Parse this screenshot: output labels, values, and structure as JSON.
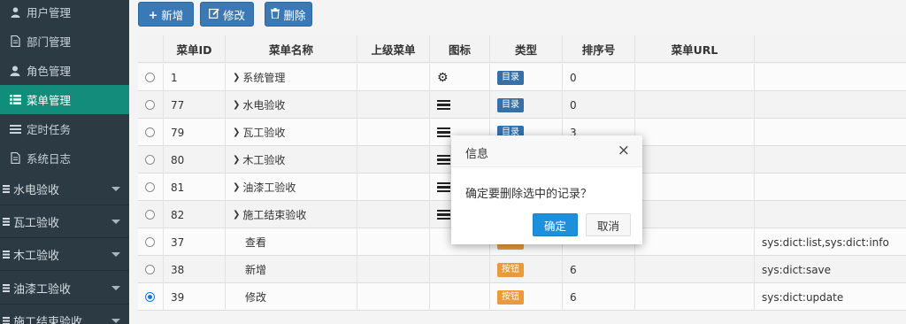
{
  "sidebar": {
    "items": [
      {
        "label": "用户管理",
        "icon": "user-icon"
      },
      {
        "label": "部门管理",
        "icon": "document-icon"
      },
      {
        "label": "角色管理",
        "icon": "role-icon"
      },
      {
        "label": "菜单管理",
        "icon": "list-icon",
        "active": true
      },
      {
        "label": "定时任务",
        "icon": "tasks-icon"
      },
      {
        "label": "系统日志",
        "icon": "document-icon"
      }
    ],
    "groups": [
      {
        "label": "水电验收"
      },
      {
        "label": "瓦工验收"
      },
      {
        "label": "木工验收"
      },
      {
        "label": "油漆工验收"
      },
      {
        "label": "施工结束验收"
      }
    ]
  },
  "toolbar": {
    "add_label": "新增",
    "edit_label": "修改",
    "delete_label": "删除"
  },
  "table": {
    "headers": [
      "",
      "菜单ID",
      "菜单名称",
      "上级菜单",
      "图标",
      "类型",
      "排序号",
      "菜单URL",
      ""
    ],
    "rows": [
      {
        "id": "1",
        "name": "系统管理",
        "parent": "",
        "icon": "gear",
        "type": "目录",
        "type_kind": "dir",
        "order": "0",
        "url": "",
        "perms": "",
        "expand": true,
        "checked": false
      },
      {
        "id": "77",
        "name": "水电验收",
        "parent": "",
        "icon": "list",
        "type": "目录",
        "type_kind": "dir",
        "order": "0",
        "url": "",
        "perms": "",
        "expand": true,
        "checked": false
      },
      {
        "id": "79",
        "name": "瓦工验收",
        "parent": "",
        "icon": "list",
        "type": "目录",
        "type_kind": "dir",
        "order": "3",
        "url": "",
        "perms": "",
        "expand": true,
        "checked": false
      },
      {
        "id": "80",
        "name": "木工验收",
        "parent": "",
        "icon": "list",
        "type": "",
        "type_kind": "",
        "order": "",
        "url": "",
        "perms": "",
        "expand": true,
        "checked": false
      },
      {
        "id": "81",
        "name": "油漆工验收",
        "parent": "",
        "icon": "list",
        "type": "",
        "type_kind": "",
        "order": "",
        "url": "",
        "perms": "",
        "expand": true,
        "checked": false
      },
      {
        "id": "82",
        "name": "施工结束验收",
        "parent": "",
        "icon": "list",
        "type": "",
        "type_kind": "",
        "order": "",
        "url": "",
        "perms": "",
        "expand": true,
        "checked": false
      },
      {
        "id": "37",
        "name": "查看",
        "parent": "",
        "icon": "",
        "type": "",
        "type_kind": "btn",
        "order": "",
        "url": "",
        "perms": "sys:dict:list,sys:dict:info",
        "expand": false,
        "checked": false
      },
      {
        "id": "38",
        "name": "新增",
        "parent": "",
        "icon": "",
        "type": "按钮",
        "type_kind": "btn",
        "order": "6",
        "url": "",
        "perms": "sys:dict:save",
        "expand": false,
        "checked": false
      },
      {
        "id": "39",
        "name": "修改",
        "parent": "",
        "icon": "",
        "type": "按钮",
        "type_kind": "btn",
        "order": "6",
        "url": "",
        "perms": "sys:dict:update",
        "expand": false,
        "checked": true
      }
    ]
  },
  "modal": {
    "title": "信息",
    "message": "确定要删除选中的记录？",
    "confirm_label": "确定",
    "cancel_label": "取消",
    "close_glyph": "×"
  },
  "colors": {
    "sidebar_bg": "#2b3a43",
    "sidebar_active": "#138c7c",
    "primary": "#3a79b5",
    "dir_tag": "#3670a8",
    "btn_tag": "#e89a3c",
    "confirm": "#1e8fdb"
  }
}
